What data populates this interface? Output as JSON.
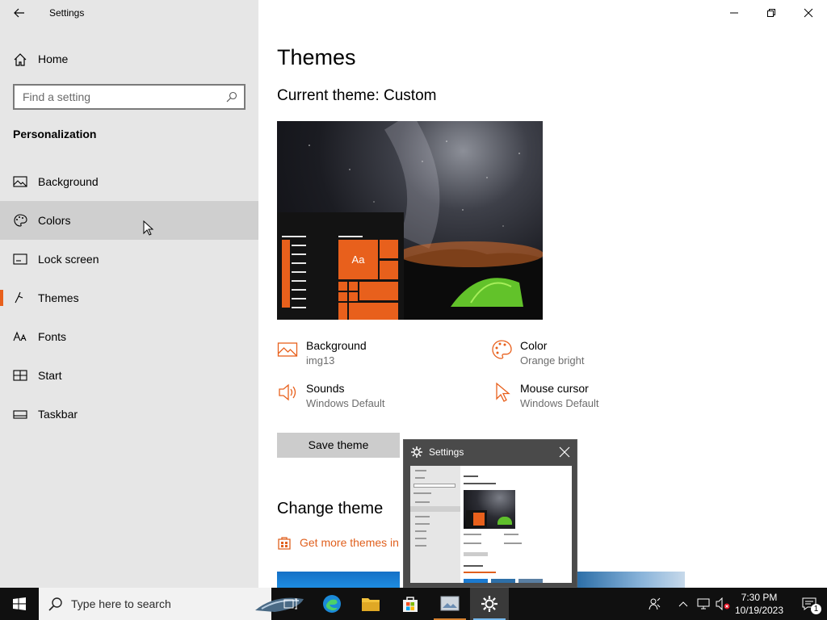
{
  "window": {
    "app_title": "Settings",
    "back_icon": "back-arrow-icon",
    "controls": {
      "minimize_icon": "minimize-icon",
      "maximize_icon": "restore-icon",
      "close_icon": "close-icon"
    }
  },
  "sidebar": {
    "home_label": "Home",
    "search_placeholder": "Find a setting",
    "section_title": "Personalization",
    "items": [
      {
        "label": "Background",
        "icon": "picture-icon"
      },
      {
        "label": "Colors",
        "icon": "palette-icon",
        "hovered": true
      },
      {
        "label": "Lock screen",
        "icon": "lock-screen-icon"
      },
      {
        "label": "Themes",
        "icon": "themes-icon",
        "selected": true
      },
      {
        "label": "Fonts",
        "icon": "fonts-icon"
      },
      {
        "label": "Start",
        "icon": "start-icon"
      },
      {
        "label": "Taskbar",
        "icon": "taskbar-icon"
      }
    ]
  },
  "main": {
    "title": "Themes",
    "current_theme": "Current theme: Custom",
    "preview": {
      "tile_label": "Aa"
    },
    "properties": [
      {
        "name": "Background",
        "value": "img13",
        "icon": "picture-icon"
      },
      {
        "name": "Color",
        "value": "Orange bright",
        "icon": "palette-icon"
      },
      {
        "name": "Sounds",
        "value": "Windows Default",
        "icon": "speaker-icon"
      },
      {
        "name": "Mouse cursor",
        "value": "Windows Default",
        "icon": "cursor-icon"
      }
    ],
    "save_label": "Save theme",
    "change_title": "Change theme",
    "store_link": "Get more themes in"
  },
  "thumbnail": {
    "title": "Settings"
  },
  "taskbar": {
    "search_placeholder": "Type here to search",
    "time": "7:30 PM",
    "date": "10/19/2023",
    "notification_count": "1"
  },
  "colors": {
    "accent": "#e8601c",
    "sidebar_bg": "#e6e6e6",
    "taskbar_bg": "#101010"
  }
}
